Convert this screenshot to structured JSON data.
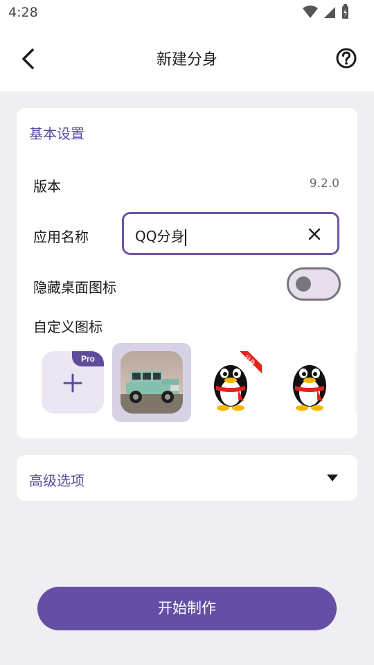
{
  "status": {
    "time": "4:28"
  },
  "appbar": {
    "title": "新建分身"
  },
  "basic": {
    "section_title": "基本设置",
    "version_label": "版本",
    "version_value": "9.2.0",
    "name_label": "应用名称",
    "name_value": "QQ分身",
    "hide_label": "隐藏桌面图标",
    "hide_enabled": false,
    "custom_icon_label": "自定义图标",
    "pro_badge": "Pro",
    "icons": [
      "add-icon",
      "car-icon",
      "qq-penguin-badge-icon",
      "qq-penguin-icon"
    ],
    "selected_icon_index": 1,
    "badge_text": "分身"
  },
  "advanced": {
    "label": "高级选项"
  },
  "actions": {
    "start_label": "开始制作"
  },
  "colors": {
    "accent": "#654fa5",
    "section": "#5b4a9e"
  }
}
